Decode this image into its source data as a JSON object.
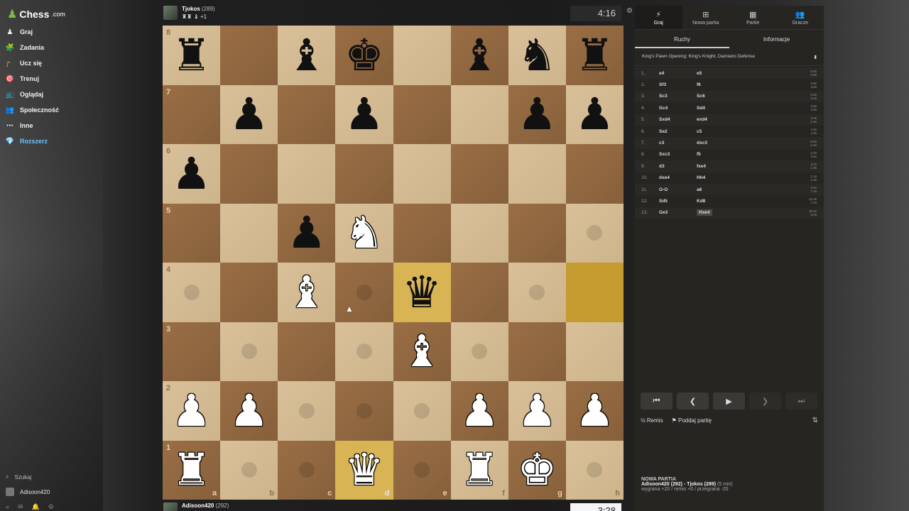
{
  "logo": {
    "text": "Chess",
    "suffix": ".com"
  },
  "nav": [
    {
      "label": "Graj",
      "icon": "♟"
    },
    {
      "label": "Zadania",
      "icon": "🧩"
    },
    {
      "label": "Ucz się",
      "icon": "🎓"
    },
    {
      "label": "Trenuj",
      "icon": "🎯"
    },
    {
      "label": "Oglądaj",
      "icon": "📺"
    },
    {
      "label": "Społeczność",
      "icon": "👥"
    },
    {
      "label": "Inne",
      "icon": "⋯"
    },
    {
      "label": "Rozszerz",
      "icon": "💎"
    }
  ],
  "search_label": "Szukaj",
  "current_user": "Adisoon420",
  "top_player": {
    "name": "Tjokos",
    "rating": "(289)",
    "captured": "♜♜ ♝ +1"
  },
  "bottom_player": {
    "name": "Adisoon420",
    "rating": "(292)"
  },
  "clock_top": "4:16",
  "clock_bottom": "3:28",
  "board": {
    "ranks": [
      "8",
      "7",
      "6",
      "5",
      "4",
      "3",
      "2",
      "1"
    ],
    "files": [
      "a",
      "b",
      "c",
      "d",
      "e",
      "f",
      "g",
      "h"
    ],
    "position": [
      [
        "bR",
        "",
        "bB",
        "bK",
        "",
        "bB",
        "bN",
        "bR"
      ],
      [
        "",
        "bP",
        "",
        "bP",
        "",
        "",
        "bP",
        "bP"
      ],
      [
        "bP",
        "",
        "",
        "",
        "",
        "",
        "",
        ""
      ],
      [
        "",
        "",
        "bP",
        "wN",
        "",
        "",
        "",
        ""
      ],
      [
        "",
        "",
        "wB",
        "",
        "bQ",
        "",
        "",
        ""
      ],
      [
        "",
        "",
        "",
        "",
        "wB",
        "",
        "",
        ""
      ],
      [
        "wP",
        "wP",
        "",
        "",
        "",
        "wP",
        "wP",
        "wP"
      ],
      [
        "wR",
        "",
        "",
        "wQ",
        "",
        "wR",
        "wK",
        ""
      ]
    ],
    "highlights": [
      "e4",
      "h4",
      "d1"
    ],
    "hints": [
      "a4",
      "d4",
      "g4",
      "h5",
      "b3",
      "d3",
      "f3",
      "c2",
      "d2",
      "e2",
      "b1",
      "c1",
      "e1",
      "h1"
    ]
  },
  "panel": {
    "tabs": [
      {
        "label": "Graj",
        "icon": "⚡"
      },
      {
        "label": "Nowa partia",
        "icon": "⊞"
      },
      {
        "label": "Partie",
        "icon": "▦"
      },
      {
        "label": "Gracze",
        "icon": "👥"
      }
    ],
    "subtabs": [
      "Ruchy",
      "Informacje"
    ],
    "opening": "King's Pawn Opening: King's Knight, Damiano Defense",
    "moves": [
      {
        "n": "1.",
        "w": "e4",
        "b": "e5",
        "t1": "0.6s",
        "t2": "0.9s"
      },
      {
        "n": "2.",
        "w": "Sf3",
        "b": "f6",
        "t1": "0.8s",
        "t2": "4.0s"
      },
      {
        "n": "3.",
        "w": "Sc3",
        "b": "Sc6",
        "t1": "0.8s",
        "t2": "3.4s"
      },
      {
        "n": "4.",
        "w": "Gc4",
        "b": "Sd4",
        "t1": "3.6s",
        "t2": "3.3s"
      },
      {
        "n": "5.",
        "w": "Sxd4",
        "b": "exd4",
        "t1": "2.0s",
        "t2": "1.6s"
      },
      {
        "n": "6.",
        "w": "Se2",
        "b": "c5",
        "t1": "4.2s",
        "t2": "4.3s"
      },
      {
        "n": "7.",
        "w": "c3",
        "b": "dxc3",
        "t1": "5.6s",
        "t2": "1.5s"
      },
      {
        "n": "8.",
        "w": "Sxc3",
        "b": "f5",
        "t1": "2.2s",
        "t2": "3.5s"
      },
      {
        "n": "9.",
        "w": "d3",
        "b": "fxe4",
        "t1": "3.7s",
        "t2": "1.8s"
      },
      {
        "n": "10.",
        "w": "dxe4",
        "b": "Hh4",
        "t1": "1.1s",
        "t2": "1.2s"
      },
      {
        "n": "11.",
        "w": "O-O",
        "b": "a6",
        "t1": "3.0s",
        "t2": "7.4s"
      },
      {
        "n": "12.",
        "w": "Sd5",
        "b": "Kd8",
        "t1": "14.3s",
        "t2": "7.2s"
      },
      {
        "n": "13.",
        "w": "Ge3",
        "b": "Hxe4",
        "t1": "15.2s",
        "t2": "5.0s"
      }
    ],
    "actions": {
      "draw": "Remis",
      "resign": "Poddaj partię"
    },
    "new_game": {
      "title": "NOWA PARTIA",
      "players": "Adisoon420 (292) - Tjokos (289)",
      "time": "(5 min)",
      "result": "wygrana +20 / remis +0 / przegrana -20"
    }
  }
}
